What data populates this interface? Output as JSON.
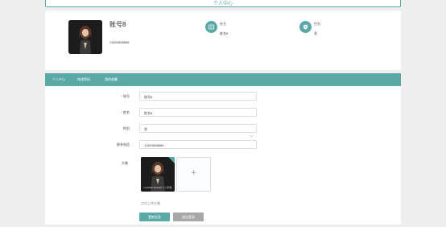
{
  "page": {
    "title": "个人中心"
  },
  "profile": {
    "username": "账号8",
    "phone": "13823888888",
    "name_label": "姓名",
    "name_value": "姓名8",
    "gender_label": "性别",
    "gender_value": "男"
  },
  "tabs": [
    {
      "label": "个人中心",
      "active": true
    },
    {
      "label": "修改密码",
      "active": false
    },
    {
      "label": "我的收藏",
      "active": false
    }
  ],
  "form": {
    "account": {
      "label": "账号",
      "value": "账号8",
      "required": "*"
    },
    "nickname": {
      "label": "姓名",
      "value": "姓名8",
      "required": "*"
    },
    "gender": {
      "label": "性别",
      "value": "男"
    },
    "phone": {
      "label": "联系电话",
      "value": "13823888888"
    },
    "avatar_label": "头像",
    "avatar_caption": "CARRIE BAKER 个人形象",
    "upload_plus": "+",
    "hint": "点击上传头像"
  },
  "buttons": {
    "update": "更新信息",
    "logout": "退出登录"
  },
  "colors": {
    "accent": "#5aa9a6",
    "logout": "#a7a7a7",
    "required": "#e04848"
  },
  "icons": {
    "name": "id-card-icon",
    "gender": "gender-shield-icon",
    "select": "chevron-down-icon",
    "upload": "plus-icon"
  }
}
